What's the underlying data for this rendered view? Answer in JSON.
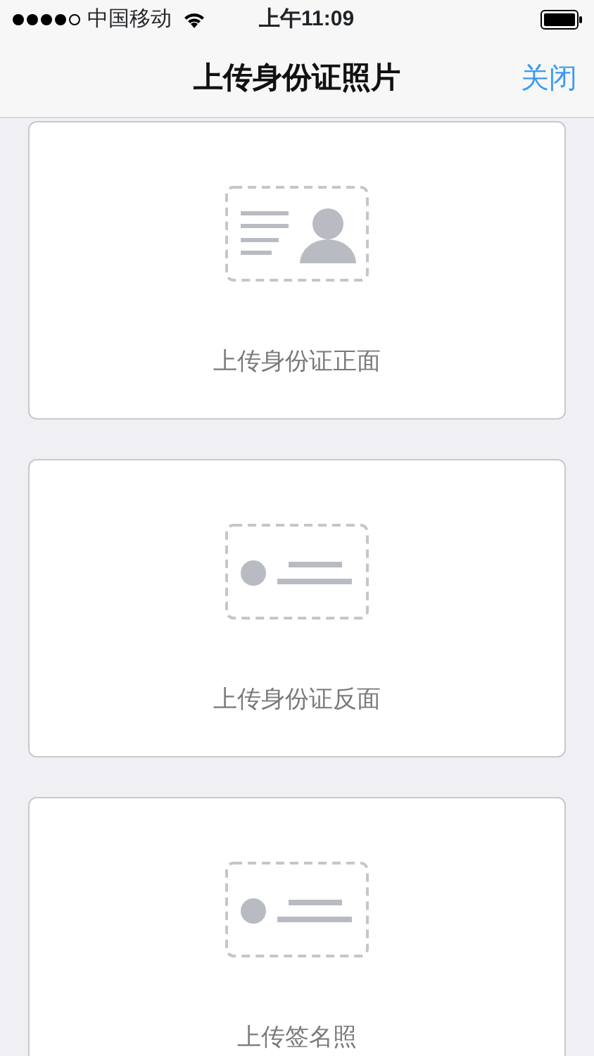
{
  "status_bar": {
    "carrier": "中国移动",
    "time": "上午11:09"
  },
  "nav_bar": {
    "title": "上传身份证照片",
    "close": "关闭"
  },
  "upload_cards": [
    {
      "kind": "front",
      "label": "上传身份证正面"
    },
    {
      "kind": "back",
      "label": "上传身份证反面"
    },
    {
      "kind": "back",
      "label": "上传签名照"
    }
  ]
}
